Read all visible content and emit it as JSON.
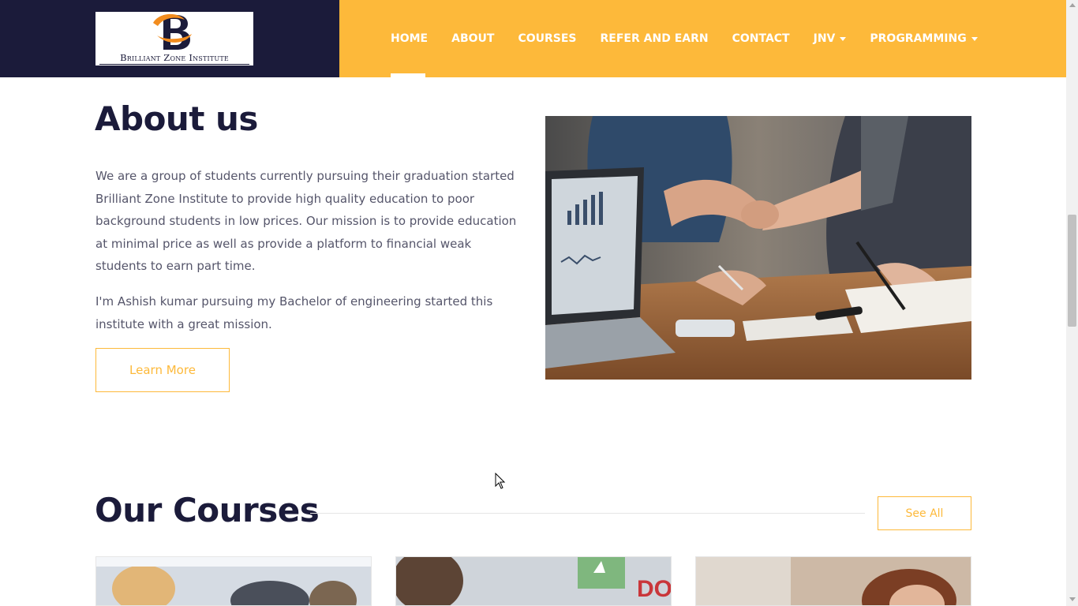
{
  "logo": {
    "text": "Brilliant Zone Institute",
    "mark_letter": "B"
  },
  "nav": {
    "items": [
      {
        "label": "HOME",
        "active": true
      },
      {
        "label": "ABOUT"
      },
      {
        "label": "COURSES"
      },
      {
        "label": "REFER AND EARN"
      },
      {
        "label": "CONTACT"
      },
      {
        "label": "JNV",
        "dropdown": true
      },
      {
        "label": "PROGRAMMING",
        "dropdown": true
      }
    ]
  },
  "about": {
    "title": "About us",
    "paragraph1": "We are a group of students currently pursuing their graduation started Brilliant Zone Institute to provide high quality education to poor background students in low prices. Our mission is to provide education at minimal price as well as provide a platform to financial weak students to earn part time.",
    "paragraph2": "I'm Ashish kumar pursuing my Bachelor of engineering started this institute with a great mission.",
    "button_label": "Learn More"
  },
  "courses": {
    "title": "Our Courses",
    "see_all_label": "See All"
  },
  "colors": {
    "navy": "#1b1b3a",
    "accent": "#fdb93a",
    "text_muted": "#55556a",
    "logo_orange": "#f28c1e"
  },
  "icons": {
    "dropdown": "caret-down-icon",
    "cursor": "mouse-pointer-icon"
  }
}
